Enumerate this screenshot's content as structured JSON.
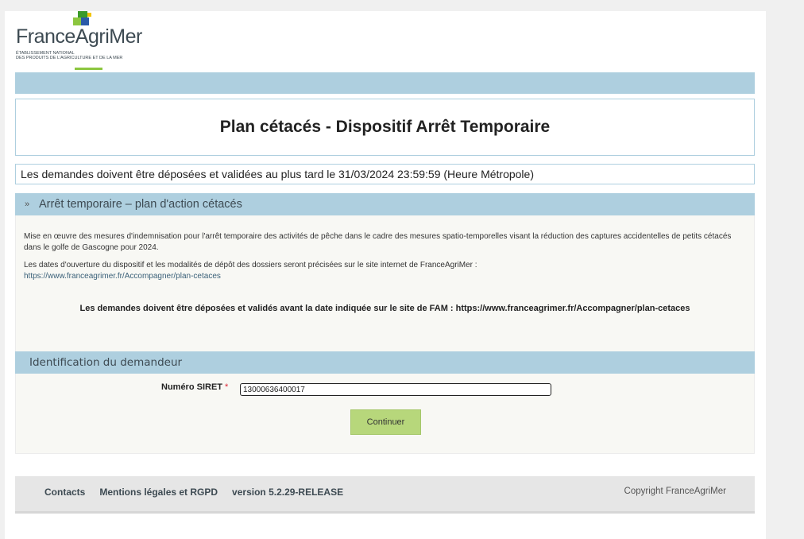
{
  "header": {
    "logo_name": "FranceAgriMer",
    "logo_subtitle": "ÉTABLISSEMENT NATIONAL\nDES PRODUITS DE L'AGRICULTURE ET DE LA MER"
  },
  "page_title": "Plan cétacés - Dispositif Arrêt Temporaire",
  "deadline_notice": "Les demandes doivent être déposées et validées au plus tard le 31/03/2024 23:59:59 (Heure Métropole)",
  "section_info": {
    "header": "Arrêt temporaire – plan d'action cétacés",
    "chevron_icon": "chevron-double-down-icon",
    "paragraph1": "Mise en œuvre des mesures d'indemnisation pour l'arrêt temporaire des activités de pêche dans le cadre des mesures spatio-temporelles visant la réduction des captures accidentelles de petits cétacés dans le golfe de Gascogne pour 2024.",
    "paragraph2": "Les dates d'ouverture du dispositif et les modalités de dépôt des dossiers seront précisées sur le site internet de FranceAgriMer :",
    "link": "https://www.franceagrimer.fr/Accompagner/plan-cetaces",
    "bold_note": "Les demandes doivent être déposées et validés avant la date indiquée sur le site de FAM : https://www.franceagrimer.fr/Accompagner/plan-cetaces"
  },
  "section_form": {
    "header": "Identification du demandeur",
    "siret_label": "Numéro SIRET",
    "required_marker": "*",
    "siret_value": "13000636400017",
    "continue_label": "Continuer"
  },
  "footer": {
    "contacts": "Contacts",
    "legal": "Mentions légales et RGPD",
    "version": "version 5.2.29-RELEASE",
    "copyright": "Copyright FranceAgriMer"
  },
  "colors": {
    "band": "#aecfdf",
    "button": "#b7d77b",
    "logo_green": "#8cc63f"
  }
}
